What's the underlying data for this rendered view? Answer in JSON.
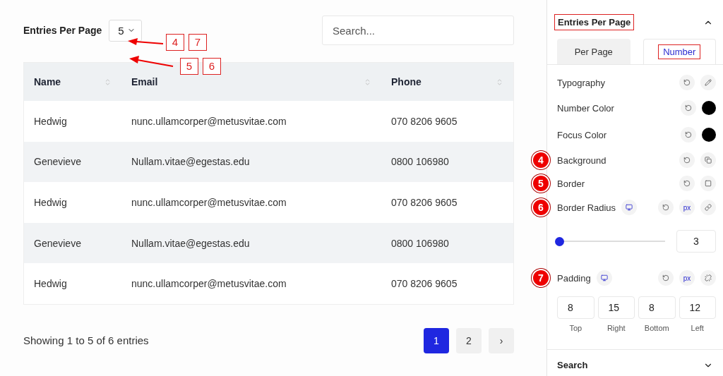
{
  "entries": {
    "label": "Entries Per Page",
    "value": "5"
  },
  "callouts": [
    {
      "labels": [
        "4",
        "7"
      ]
    },
    {
      "labels": [
        "5",
        "6"
      ]
    }
  ],
  "search": {
    "placeholder": "Search..."
  },
  "table": {
    "columns": [
      "Name",
      "Email",
      "Phone"
    ],
    "rows": [
      [
        "Hedwig",
        "nunc.ullamcorper@metusvitae.com",
        "070 8206 9605"
      ],
      [
        "Genevieve",
        "Nullam.vitae@egestas.edu",
        "0800 106980"
      ],
      [
        "Hedwig",
        "nunc.ullamcorper@metusvitae.com",
        "070 8206 9605"
      ],
      [
        "Genevieve",
        "Nullam.vitae@egestas.edu",
        "0800 106980"
      ],
      [
        "Hedwig",
        "nunc.ullamcorper@metusvitae.com",
        "070 8206 9605"
      ]
    ]
  },
  "footer": {
    "info": "Showing 1 to 5 of 6 entries",
    "pages": [
      {
        "label": "1",
        "selected": true
      },
      {
        "label": "2",
        "selected": false
      }
    ],
    "next": "›"
  },
  "panel": {
    "section": {
      "title": "Entries Per Page",
      "highlighted": true,
      "expanded": true
    },
    "tabs": [
      {
        "label": "Per Page",
        "selected": false,
        "highlighted": false
      },
      {
        "label": "Number",
        "selected": true,
        "highlighted": true
      }
    ],
    "controls": [
      {
        "kind": "typography",
        "label": "Typography"
      },
      {
        "kind": "color",
        "label": "Number Color",
        "color": "#000000"
      },
      {
        "kind": "color",
        "label": "Focus Color",
        "color": "#000000"
      },
      {
        "kind": "background",
        "label": "Background",
        "badge": "4"
      },
      {
        "kind": "border",
        "label": "Border",
        "badge": "5"
      },
      {
        "kind": "radius",
        "label": "Border Radius",
        "badge": "6",
        "unit": "px",
        "level": 0.02,
        "value": "3"
      },
      {
        "kind": "padding",
        "label": "Padding",
        "badge": "7",
        "unit": "px",
        "sides": [
          {
            "value": "8",
            "label": "Top"
          },
          {
            "value": "15",
            "label": "Right"
          },
          {
            "value": "8",
            "label": "Bottom"
          },
          {
            "value": "12",
            "label": "Left"
          }
        ]
      }
    ],
    "next_section": {
      "title": "Search",
      "expanded": false
    }
  }
}
